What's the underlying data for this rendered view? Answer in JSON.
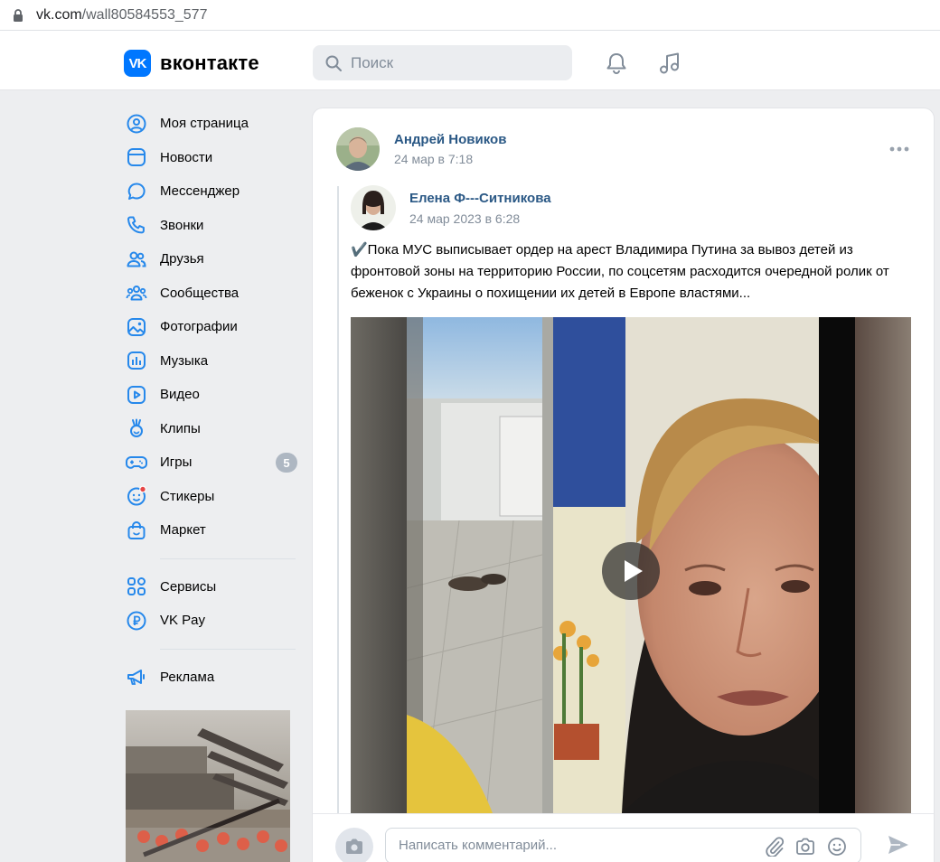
{
  "browser": {
    "url_host": "vk.com",
    "url_path": "/wall80584553_577"
  },
  "header": {
    "brand": "вконтакте",
    "logo_text": "VK",
    "search_placeholder": "Поиск"
  },
  "sidebar": {
    "items": [
      {
        "label": "Моя страница",
        "icon": "user-circle-icon"
      },
      {
        "label": "Новости",
        "icon": "newsfeed-icon"
      },
      {
        "label": "Мессенджер",
        "icon": "message-icon"
      },
      {
        "label": "Звонки",
        "icon": "phone-icon"
      },
      {
        "label": "Друзья",
        "icon": "friends-icon"
      },
      {
        "label": "Сообщества",
        "icon": "communities-icon"
      },
      {
        "label": "Фотографии",
        "icon": "photos-icon"
      },
      {
        "label": "Музыка",
        "icon": "music-icon"
      },
      {
        "label": "Видео",
        "icon": "video-icon"
      },
      {
        "label": "Клипы",
        "icon": "clips-icon"
      },
      {
        "label": "Игры",
        "icon": "games-icon",
        "badge": "5"
      },
      {
        "label": "Стикеры",
        "icon": "stickers-icon"
      },
      {
        "label": "Маркет",
        "icon": "market-icon"
      }
    ],
    "items2": [
      {
        "label": "Сервисы",
        "icon": "services-icon"
      },
      {
        "label": "VK Pay",
        "icon": "vkpay-icon"
      }
    ],
    "items3": [
      {
        "label": "Реклама",
        "icon": "megaphone-icon"
      }
    ]
  },
  "post": {
    "author": "Андрей Новиков",
    "date": "24 мар в 7:18",
    "repost": {
      "author": "Елена Ф---Ситникова",
      "date": "24 мар 2023 в 6:28",
      "text": "✔️Пока МУС выписывает ордер на арест Владимира Путина за вывоз детей из фронтовой зоны на территорию России, по соцсетям расходится очередной ролик от беженок с Украины о похищении их детей в Европе властями..."
    }
  },
  "comment": {
    "placeholder": "Написать комментарий..."
  },
  "colors": {
    "accent": "#2a5885",
    "vk_blue": "#0077ff",
    "icon_blue": "#2688eb",
    "bg": "#edeef0"
  }
}
